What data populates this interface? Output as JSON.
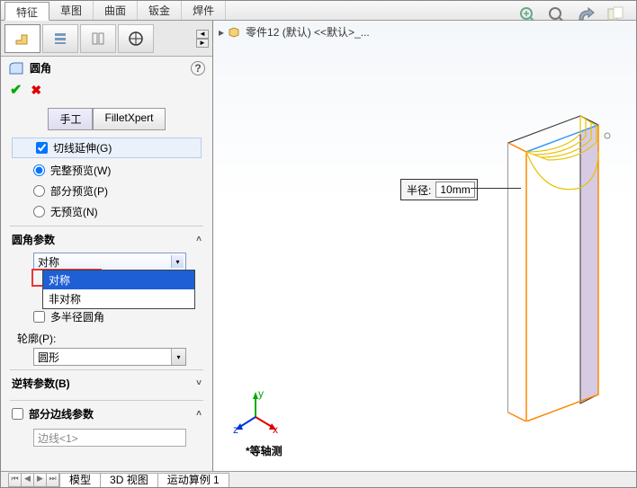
{
  "topTabs": {
    "items": [
      "特征",
      "草图",
      "曲面",
      "钣金",
      "焊件"
    ],
    "active": 0
  },
  "breadcrumb": {
    "part": "零件12 (默认) <<默认>_..."
  },
  "feature": {
    "title": "圆角",
    "help": "?",
    "ok": "✔",
    "cancel": "✖"
  },
  "modes": {
    "manual": "手工",
    "xpert": "FilletXpert"
  },
  "preview": {
    "tangentExt": "切线延伸(G)",
    "full": "完整预览(W)",
    "partial": "部分预览(P)",
    "none": "无预览(N)"
  },
  "sections": {
    "params": "圆角参数",
    "reverse": "逆转参数(B)",
    "partialEdges": "部分边线参数"
  },
  "params": {
    "comboValue": "对称",
    "options": [
      "对称",
      "非对称"
    ],
    "multiRadius": "多半径圆角",
    "profileLabel": "轮廓(P):",
    "profileValue": "圆形"
  },
  "edges": {
    "placeholder": "边线<1>"
  },
  "callout": {
    "label": "半径:",
    "value": "10mm"
  },
  "triad": {
    "x": "x",
    "y": "y",
    "z": "z"
  },
  "isoLabel": "*等轴测",
  "bottomTabs": {
    "items": [
      "模型",
      "3D 视图",
      "运动算例 1"
    ]
  }
}
